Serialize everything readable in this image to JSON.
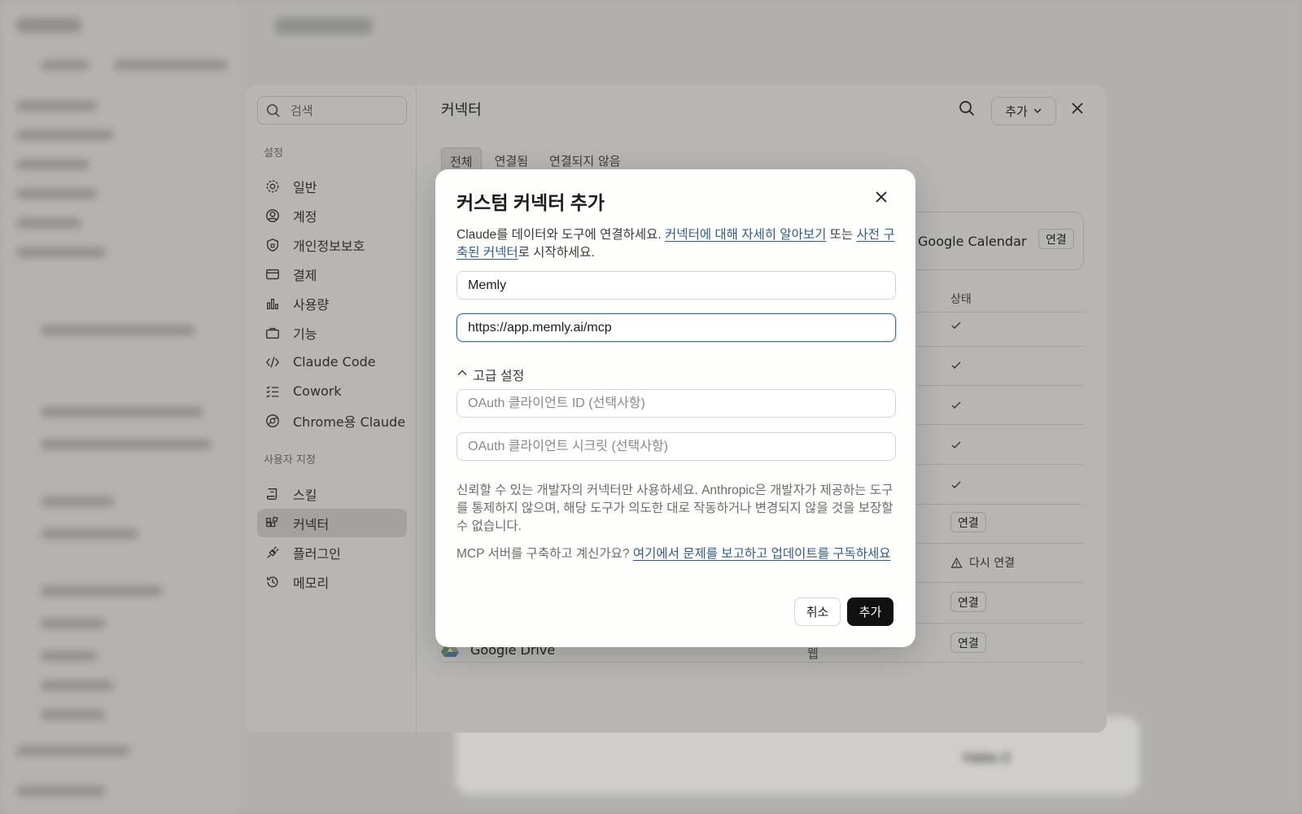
{
  "settings": {
    "search_placeholder": "검색",
    "section_settings": "설정",
    "section_custom": "사용자 지정",
    "nav": [
      {
        "label": "일반"
      },
      {
        "label": "계정"
      },
      {
        "label": "개인정보보호"
      },
      {
        "label": "결제"
      },
      {
        "label": "사용량"
      },
      {
        "label": "기능"
      },
      {
        "label": "Claude Code"
      },
      {
        "label": "Cowork"
      },
      {
        "label": "Chrome용 Claude"
      }
    ],
    "custom_nav": [
      {
        "label": "스킬"
      },
      {
        "label": "커넥터",
        "active": true
      },
      {
        "label": "플러그인"
      },
      {
        "label": "메모리"
      }
    ],
    "page_title": "커넥터",
    "add_dropdown": "추가",
    "tabs": [
      "전체",
      "연결됨",
      "연결되지 않음"
    ],
    "gcal_name": "Google Calendar",
    "connect_label": "연결",
    "status_header": "상태",
    "reconnect_label": "다시 연결",
    "gdrive_name": "Google Drive",
    "gdrive_type": "웹"
  },
  "modal": {
    "title": "커스텀 커넥터 추가",
    "desc_prefix": "Claude를 데이터와 도구에 연결하세요. ",
    "desc_link1": "커넥터에 대해 자세히 알아보기",
    "desc_mid": " 또는 ",
    "desc_link2": "사전 구축된 커넥터",
    "desc_suffix": "로 시작하세요.",
    "name_value": "Memly",
    "url_value": "https://app.memly.ai/mcp",
    "advanced_label": "고급 설정",
    "client_id_placeholder": "OAuth 클라이언트 ID (선택사항)",
    "client_secret_placeholder": "OAuth 클라이언트 시크릿 (선택사항)",
    "warning": "신뢰할 수 있는 개발자의 커넥터만 사용하세요. Anthropic은 개발자가 제공하는 도구를 통제하지 않으며, 해당 도구가 의도한 대로 작동하거나 변경되지 않을 것을 보장할 수 없습니다.",
    "mcp_prefix": "MCP 서버를 구축하고 계신가요? ",
    "mcp_link": "여기에서 문제를 보고하고 업데이트를 구독하세요",
    "cancel_label": "취소",
    "add_label": "추가"
  },
  "composer": {
    "model": "Fable 5"
  },
  "colors": {
    "link": "#2f5a8a",
    "focus": "#3e6ea8",
    "primary_button": "#111111"
  }
}
